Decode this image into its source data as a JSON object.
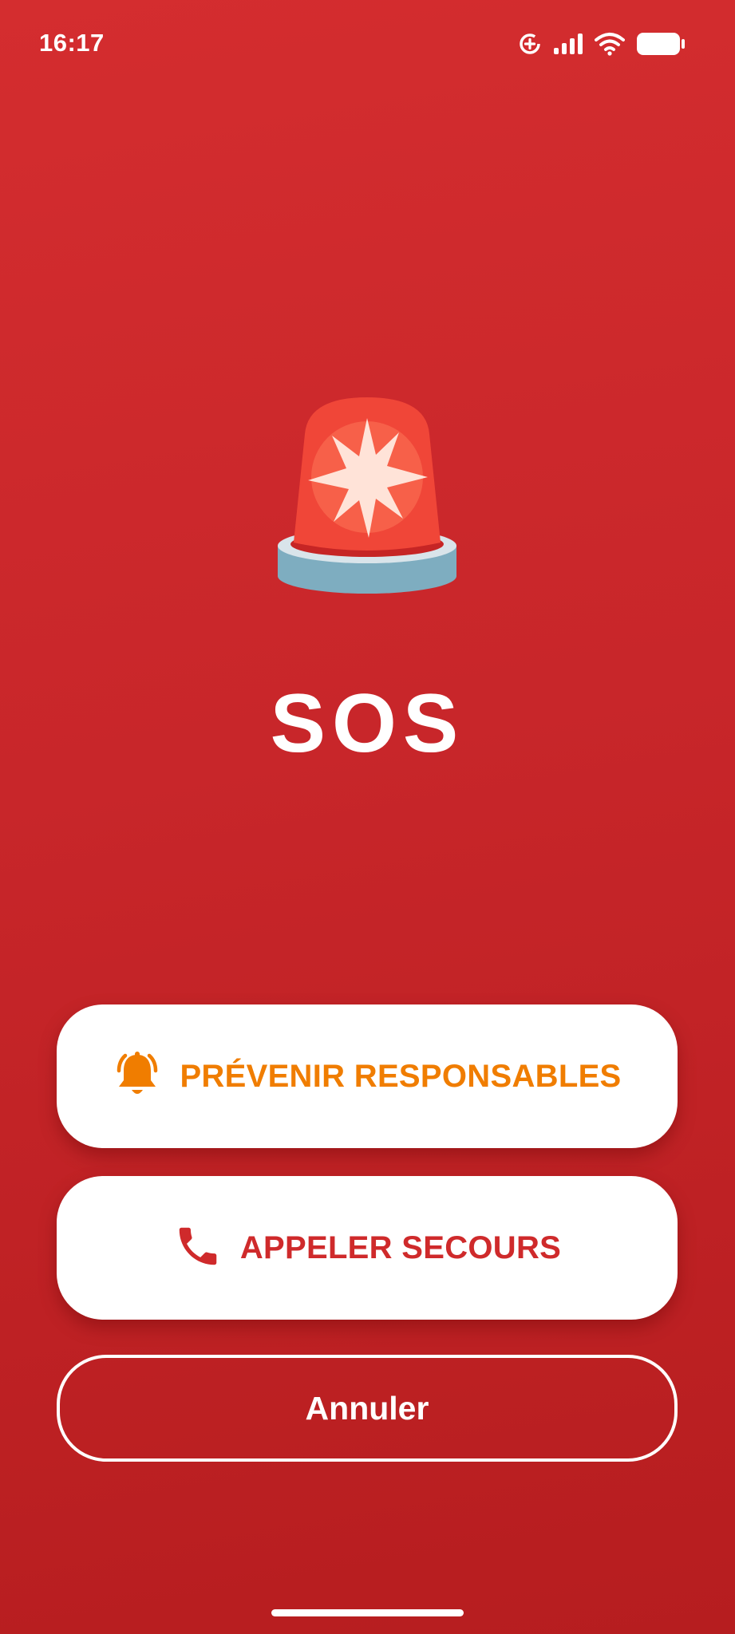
{
  "status_bar": {
    "time": "16:17",
    "icons": [
      "data-saver-icon",
      "signal-icon",
      "wifi-icon",
      "battery-icon"
    ]
  },
  "screen": {
    "title": "SOS",
    "illustration": "siren-icon"
  },
  "actions": {
    "notify_label": "PRÉVENIR RESPONSABLES",
    "notify_icon": "bell-alert-icon",
    "call_label": "APPELER SECOURS",
    "call_icon": "phone-icon",
    "cancel_label": "Annuler"
  },
  "colors": {
    "background": "#c8262a",
    "notify_accent": "#f07d00",
    "call_accent": "#cf2a2b",
    "button_bg": "#ffffff"
  }
}
